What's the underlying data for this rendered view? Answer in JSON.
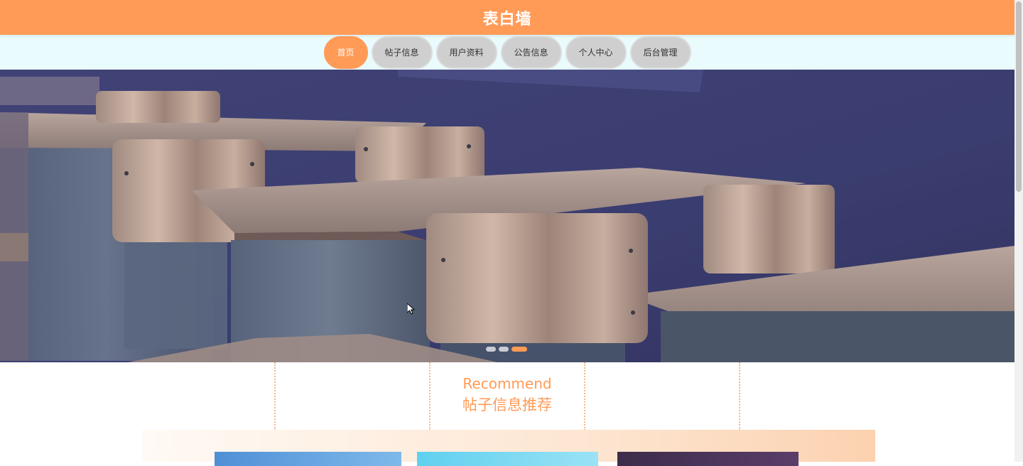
{
  "header": {
    "title": "表白墙"
  },
  "nav": {
    "items": [
      {
        "label": "首页",
        "active": true
      },
      {
        "label": "帖子信息",
        "active": false
      },
      {
        "label": "用户资料",
        "active": false
      },
      {
        "label": "公告信息",
        "active": false
      },
      {
        "label": "个人中心",
        "active": false
      },
      {
        "label": "后台管理",
        "active": false
      }
    ]
  },
  "banner": {
    "slide_count": 3,
    "active_slide": 3
  },
  "recommend": {
    "title_en": "Recommend",
    "title_cn": "帖子信息推荐"
  },
  "colors": {
    "accent": "#ff9b57",
    "nav_bg": "#e9fbfd",
    "inactive_pill": "#cfcfcf"
  }
}
